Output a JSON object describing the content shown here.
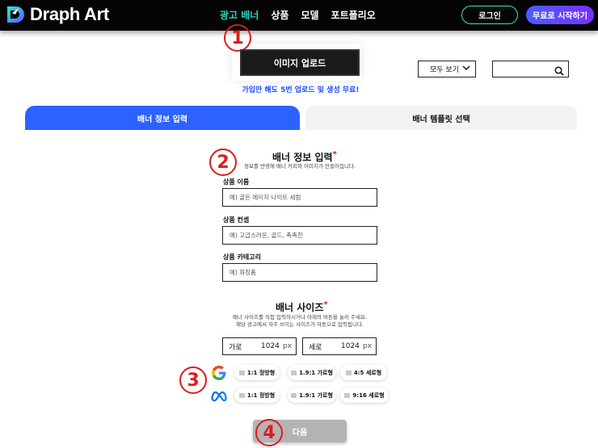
{
  "header": {
    "logo_text": "Draph Art",
    "nav": [
      {
        "label": "광고 배너",
        "active": true
      },
      {
        "label": "상품",
        "active": false
      },
      {
        "label": "모델",
        "active": false
      },
      {
        "label": "포트폴리오",
        "active": false
      }
    ],
    "login_label": "로그인",
    "start_label": "무료로 시작하기"
  },
  "markers": [
    "1",
    "2",
    "3",
    "4"
  ],
  "upload": {
    "button_label": "이미지 업로드",
    "promo_text": "가입만 해도 5번 업로드 및 생성 무료!"
  },
  "filter": {
    "view_label": "모두 보기",
    "search_placeholder": ""
  },
  "tabs": {
    "left": "배너 정보 입력",
    "right": "배너 템플릿 선택"
  },
  "info_section": {
    "title": "배너 정보 입력",
    "required_mark": "*",
    "description": "정보를 반영해 배너 카피와 이미지가 만들어집니다.",
    "fields": [
      {
        "label": "상품 이름",
        "placeholder": "예) 골든 에이지 나이트 세럼"
      },
      {
        "label": "상품 컨셉",
        "placeholder": "예) 고급스러운, 골드, 촉촉한"
      },
      {
        "label": "상품 카테고리",
        "placeholder": "예) 화장품"
      }
    ]
  },
  "size_section": {
    "title": "배너 사이즈",
    "required_mark": "*",
    "description_line1": "배너 사이즈를 직접 입력하시거나 아래의 버튼을 눌러 주세요.",
    "description_line2": "해당 광고에서 자주 쓰이는 사이즈가 자동으로 입력됩니다.",
    "width": {
      "label": "가로",
      "value": "1024",
      "unit": "px"
    },
    "height": {
      "label": "세로",
      "value": "1024",
      "unit": "px"
    },
    "google_presets": [
      "1:1 정방형",
      "1.9:1 가로형",
      "4:5 세로형"
    ],
    "meta_presets": [
      "1:1 정방형",
      "1.9:1 가로형",
      "9:16 세로형"
    ]
  },
  "next_label": "다음",
  "colors": {
    "accent_teal": "#2fd3c2",
    "primary_blue": "#2d62ff",
    "marker_red": "#e01a1a"
  }
}
